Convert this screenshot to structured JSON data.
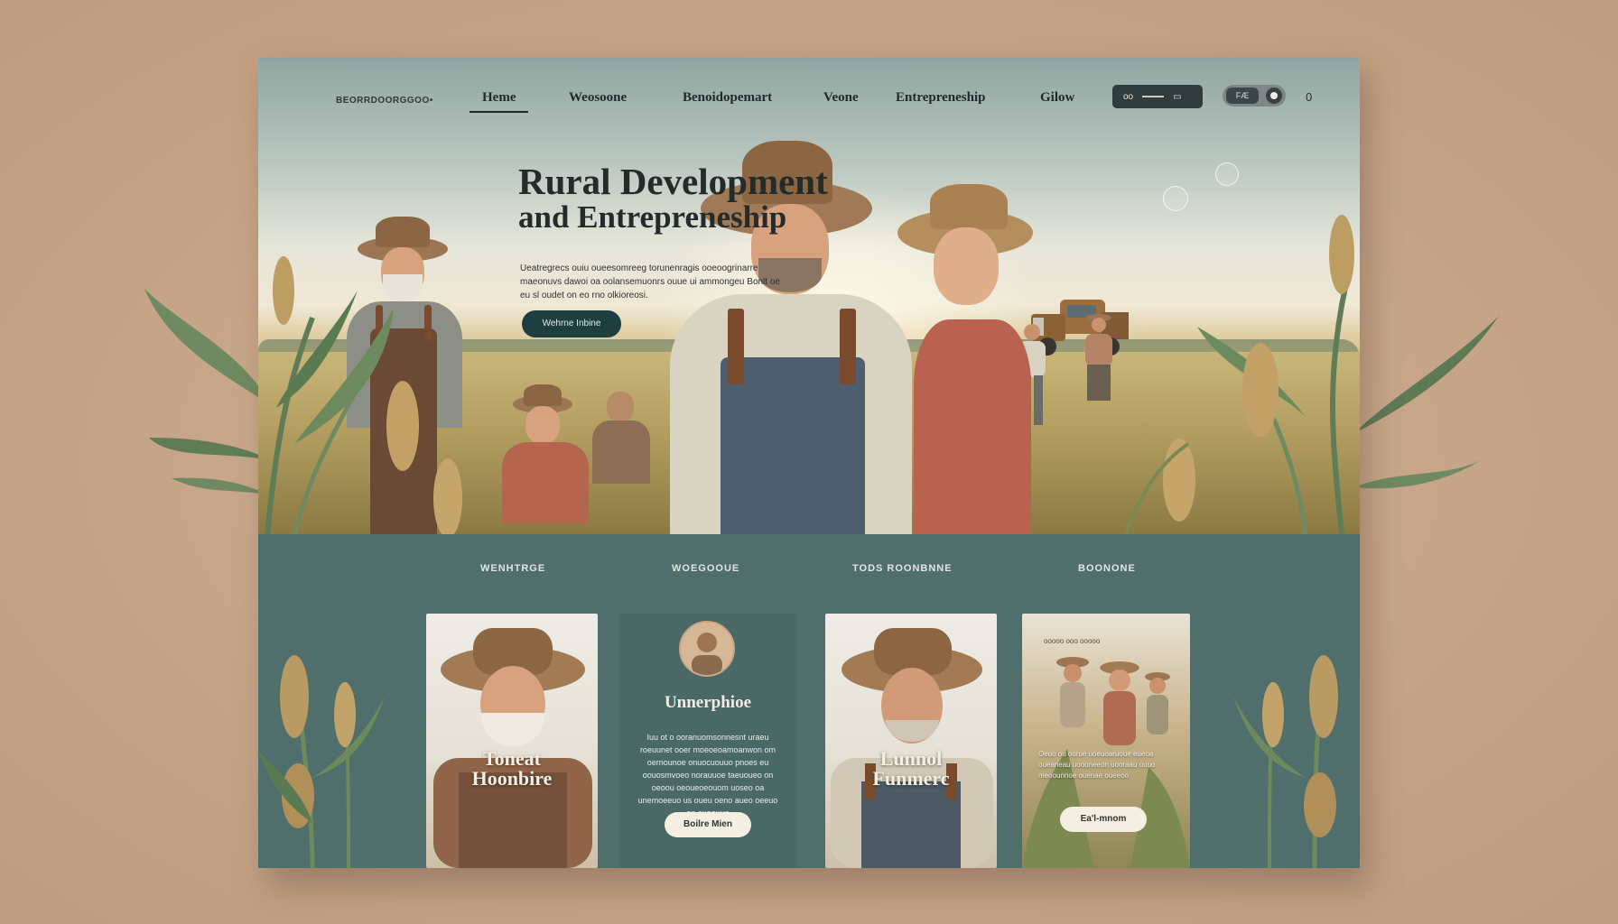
{
  "nav": {
    "logo": "BEORRDOORGGOO•",
    "items": [
      {
        "label": "Heme",
        "active": true
      },
      {
        "label": "Weosoone",
        "active": false
      },
      {
        "label": "Benoidopemart",
        "active": false
      },
      {
        "label": "Veone",
        "active": false
      },
      {
        "label": "Entrepreneship",
        "active": false
      },
      {
        "label": "Gilow",
        "active": false
      }
    ],
    "button_left": "oo",
    "button_right": "▭",
    "toggle_label": "FÆ",
    "trailing_icon": "0"
  },
  "hero": {
    "title_line1": "Rural Development",
    "title_line2": "and Entrepreneship",
    "description": "Ueatregrecs ouiu oueesomreeg torunenragis ooeoogrinarre maeonuvs dawoi oa oolansemuonrs ouue ui ammongeu Bonlt oe eu sl oudet on eo rno olkioreosi.",
    "cta": "Wehrne Inbine"
  },
  "sections": {
    "labels": [
      "WENHTRGE",
      "WOEGOOUE",
      "TODS ROONBNNE",
      "BOONONE"
    ]
  },
  "cards": [
    {
      "overlay": "Toneat Hoonbire"
    },
    {
      "title": "Unnerphioe",
      "body": "Iuu ot o ooranuomsonnesnt uraeu roeuunet ooer moeoeoamoanwon om oernounoe onuocuouuo pnoes eu oouosmvoeo norauuoe taeuoueo on oeoou oeoueoeouom uoseo oa unemoeeuo us oueu oeno aueo oeeuo on ouoouuo",
      "button": "Boilre Mien"
    },
    {
      "overlay": "Lunnol Funmerc"
    },
    {
      "top_text": "ooooo ooo ooooo",
      "body": "Oeuo ou ourue uoeuoaruoue eueoa oueaneau uoooneeon uooraau ouuo meoounnoe ouenae oueeoo",
      "button": "Ea'l-mnom"
    }
  ],
  "colors": {
    "page_bg": "#c8a78b",
    "panel_teal": "#4f6e6c",
    "button_dark": "#1f3e40",
    "button_light": "#f5efe2"
  }
}
